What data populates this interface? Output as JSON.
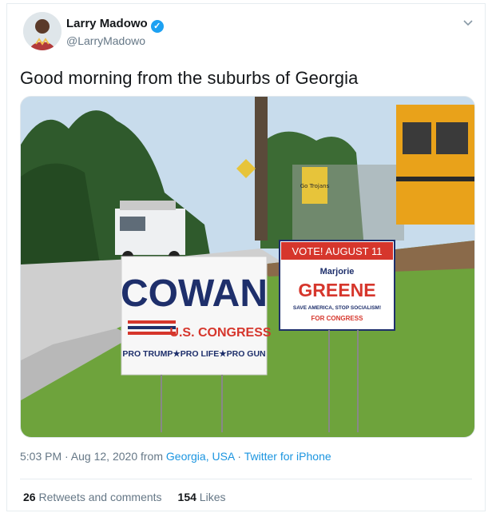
{
  "author": {
    "name": "Larry Madowo",
    "handle": "@LarryMadowo",
    "verified_icon": "verified-badge-icon"
  },
  "tweet": {
    "text": "Good morning from the suburbs of Georgia"
  },
  "photo": {
    "sign_cowan": {
      "name": "COWAN",
      "office": "U.S. CONGRESS",
      "tagline": "PRO TRUMP★PRO LIFE★PRO GUN"
    },
    "sign_greene": {
      "vote": "VOTE! AUGUST 11",
      "first": "Marjorie",
      "last": "GREENE",
      "slogan": "SAVE AMERICA, STOP SOCIALISM!",
      "office": "FOR CONGRESS"
    },
    "fence_sign": "Go Trojans"
  },
  "meta": {
    "time_date": "5:03 PM · Aug 12, 2020 from ",
    "location": "Georgia, USA",
    "separator": " · ",
    "source": "Twitter for iPhone"
  },
  "stats": {
    "retweets_count": "26",
    "retweets_label": "Retweets and comments",
    "likes_count": "154",
    "likes_label": "Likes"
  },
  "colors": {
    "accent": "#1da1f2",
    "link": "#1b95e0",
    "muted": "#657786"
  }
}
